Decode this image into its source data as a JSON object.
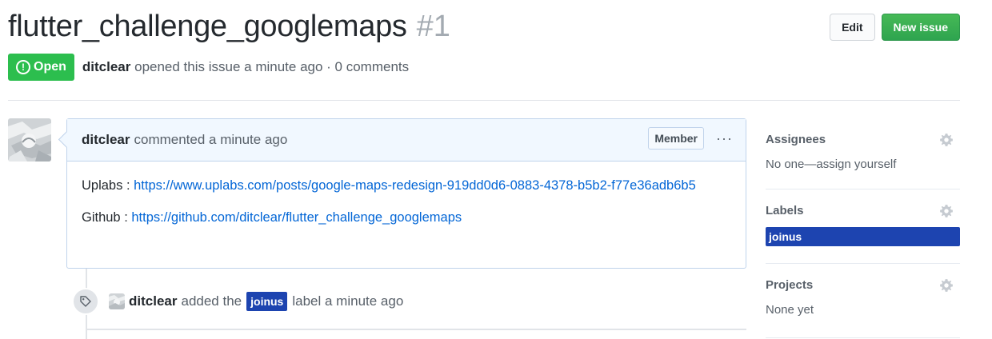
{
  "issue": {
    "title": "flutter_challenge_googlemaps",
    "number": "#1",
    "state": "Open",
    "author": "ditclear",
    "meta": "opened this issue a minute ago · 0 comments"
  },
  "header_actions": {
    "edit_label": "Edit",
    "new_issue_label": "New issue"
  },
  "comment": {
    "author": "ditclear",
    "meta": "commented a minute ago",
    "badge": "Member",
    "more_icon": "···",
    "line1_prefix": "Uplabs : ",
    "line1_link": "https://www.uplabs.com/posts/google-maps-redesign-919dd0d6-0883-4378-b5b2-f77e36adb6b5",
    "line2_prefix": "Github : ",
    "line2_link": "https://github.com/ditclear/flutter_challenge_googlemaps"
  },
  "event": {
    "author": "ditclear",
    "before": "added the",
    "label": "joinus",
    "after": "label a minute ago"
  },
  "sidebar": {
    "assignees": {
      "title": "Assignees",
      "value": "No one—assign yourself"
    },
    "labels": {
      "title": "Labels",
      "label": "joinus"
    },
    "projects": {
      "title": "Projects",
      "value": "None yet"
    }
  },
  "colors": {
    "open_green": "#2cbe4e",
    "label_blue": "#1d44b0",
    "link_blue": "#0366d6"
  },
  "icons": [
    "issue-opened-icon",
    "kebab-horizontal-icon",
    "tag-icon",
    "gear-icon"
  ]
}
